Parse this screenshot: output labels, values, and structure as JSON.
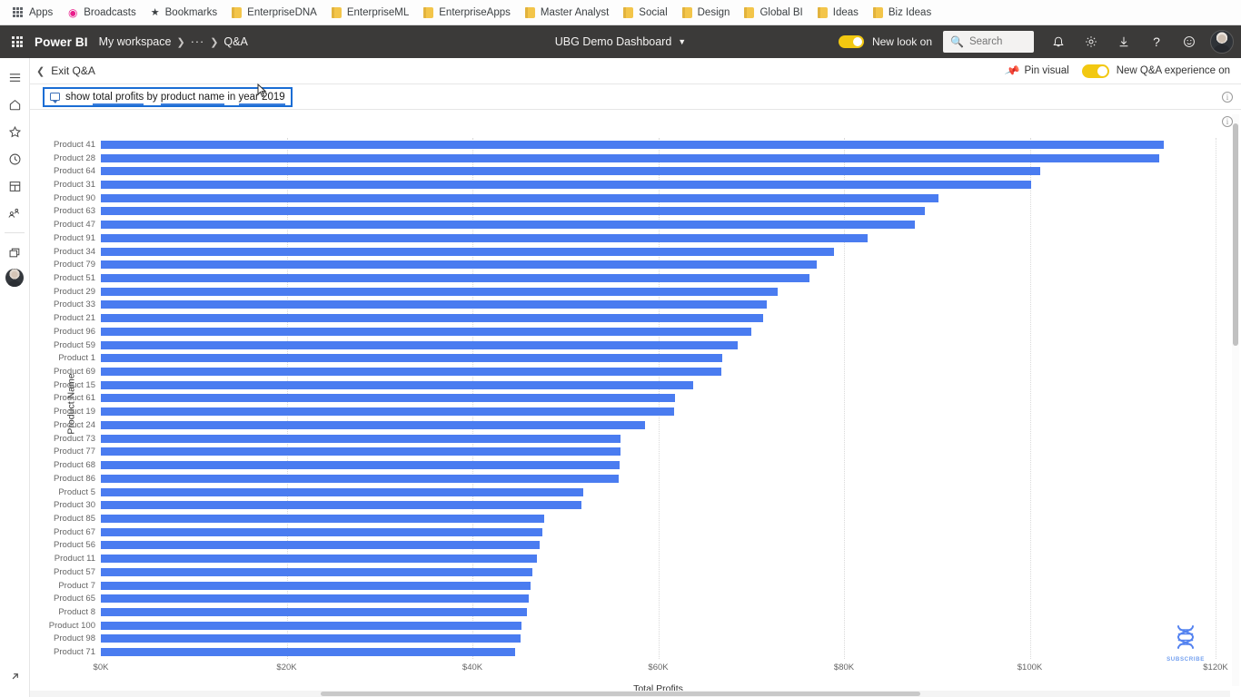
{
  "browser": {
    "bookmarks": [
      {
        "label": "Apps",
        "icon": "apps-grid-icon"
      },
      {
        "label": "Broadcasts",
        "icon": "broadcast-icon"
      },
      {
        "label": "Bookmarks",
        "icon": "star-icon"
      },
      {
        "label": "EnterpriseDNA",
        "icon": "folder-icon"
      },
      {
        "label": "EnterpriseML",
        "icon": "folder-icon"
      },
      {
        "label": "EnterpriseApps",
        "icon": "folder-icon"
      },
      {
        "label": "Master Analyst",
        "icon": "folder-icon"
      },
      {
        "label": "Social",
        "icon": "folder-icon"
      },
      {
        "label": "Design",
        "icon": "folder-icon"
      },
      {
        "label": "Global BI",
        "icon": "folder-icon"
      },
      {
        "label": "Ideas",
        "icon": "folder-icon"
      },
      {
        "label": "Biz Ideas",
        "icon": "folder-icon"
      }
    ]
  },
  "topbar": {
    "waffle_icon": "waffle-grid-icon",
    "brand": "Power BI",
    "breadcrumb": {
      "workspace": "My workspace",
      "overflow": "···",
      "current": "Q&A"
    },
    "report_title": "UBG Demo Dashboard",
    "newlook_label": "New look on",
    "newlook_on": true,
    "search_placeholder": "Search",
    "search_value": "",
    "tools": [
      {
        "name": "notifications-icon",
        "glyph": "ὑ4"
      },
      {
        "name": "settings-gear-icon",
        "glyph": "⚙"
      },
      {
        "name": "download-icon",
        "glyph": "↓"
      },
      {
        "name": "help-icon",
        "glyph": "?"
      },
      {
        "name": "feedback-smiley-icon",
        "glyph": "☺"
      }
    ],
    "accent_yellow": "#f2c811",
    "bar_background": "#3b3a39"
  },
  "qa_toolbar": {
    "exit_label": "Exit Q&A",
    "pin_visual_label": "Pin visual",
    "new_experience_label": "New Q&A experience on",
    "new_experience_on": true
  },
  "qa_query": {
    "text_segments": [
      {
        "text": "show ",
        "highlight": false
      },
      {
        "text": "total profits",
        "highlight": true
      },
      {
        "text": " by ",
        "highlight": false
      },
      {
        "text": "product name",
        "highlight": true
      },
      {
        "text": " in ",
        "highlight": false
      },
      {
        "text": "year 2019",
        "highlight": true
      }
    ],
    "full_text": "show total profits by product name in year 2019",
    "border_color": "#1a6dd4",
    "info_icon": "info-circle-icon"
  },
  "rail": {
    "items": [
      {
        "name": "hamburger-menu-icon",
        "label": "Navigation"
      },
      {
        "name": "home-icon",
        "label": "Home"
      },
      {
        "name": "favorites-star-icon",
        "label": "Favorites"
      },
      {
        "name": "recent-clock-icon",
        "label": "Recent"
      },
      {
        "name": "apps-icon",
        "label": "Apps"
      },
      {
        "name": "shared-with-me-icon",
        "label": "Shared with me"
      },
      {
        "name": "workspaces-icon",
        "label": "Workspaces"
      },
      {
        "name": "my-workspace-avatar",
        "label": "My workspace"
      }
    ],
    "bottom_item": {
      "name": "expand-arrow-icon",
      "label": "Expand"
    }
  },
  "watermark": {
    "icon": "dna-helix-icon",
    "text": "SUBSCRIBE"
  },
  "chart_data": {
    "type": "bar",
    "orientation": "horizontal",
    "title": "",
    "xlabel": "Total Profits",
    "ylabel": "Product Name",
    "xlim": [
      0,
      120000
    ],
    "xticks": [
      0,
      20000,
      40000,
      60000,
      80000,
      100000,
      120000
    ],
    "xtick_labels": [
      "$0K",
      "$20K",
      "$40K",
      "$60K",
      "$80K",
      "$100K",
      "$120K"
    ],
    "grid": true,
    "legend": false,
    "bar_color": "#4a7cf0",
    "categories": [
      "Product 41",
      "Product 28",
      "Product 64",
      "Product 31",
      "Product 90",
      "Product 63",
      "Product 47",
      "Product 91",
      "Product 34",
      "Product 79",
      "Product 51",
      "Product 29",
      "Product 33",
      "Product 21",
      "Product 96",
      "Product 59",
      "Product 1",
      "Product 69",
      "Product 15",
      "Product 61",
      "Product 19",
      "Product 24",
      "Product 73",
      "Product 77",
      "Product 68",
      "Product 86",
      "Product 5",
      "Product 30",
      "Product 85",
      "Product 67",
      "Product 56",
      "Product 11",
      "Product 57",
      "Product 7",
      "Product 65",
      "Product 8",
      "Product 100",
      "Product 98",
      "Product 71"
    ],
    "values": [
      114400,
      113900,
      101100,
      100100,
      90200,
      88700,
      87600,
      82500,
      78900,
      77100,
      76300,
      72900,
      71700,
      71300,
      70000,
      68600,
      66900,
      66800,
      63800,
      61800,
      61700,
      58600,
      55900,
      55900,
      55800,
      55700,
      51900,
      51700,
      47700,
      47500,
      47200,
      46900,
      46500,
      46300,
      46100,
      45900,
      45300,
      45200,
      44600
    ]
  }
}
